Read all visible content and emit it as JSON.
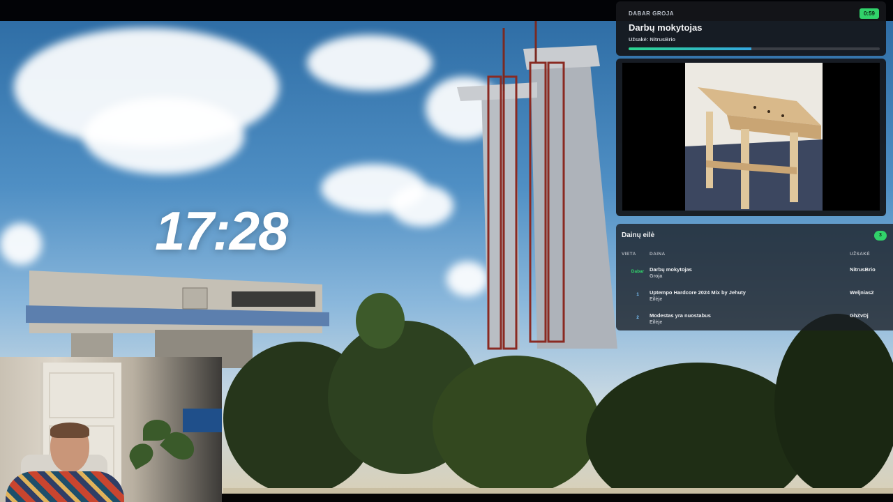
{
  "clock": {
    "time": "17:28"
  },
  "now_playing": {
    "label": "DABAR GROJA",
    "time_left": "0:59",
    "title": "Darbų mokytojas",
    "requested_by": "Užsakė: NitrusBrio",
    "progress": 0.49
  },
  "video": {
    "subject": "wooden workbench"
  },
  "queue": {
    "title": "Dainų eilė",
    "count": "3",
    "columns": {
      "position": "VIETA",
      "song": "DAINA",
      "requester": "UŽSAKĖ"
    },
    "rows": [
      {
        "position": "Dabar",
        "song": "Darbų mokytojas",
        "status": "Groja",
        "requester": "NitrusBrio"
      },
      {
        "position": "1",
        "song": "Uptempo Hardcore 2024 Mix by Jehuty",
        "status": "Eilėje",
        "requester": "Weljnias2"
      },
      {
        "position": "2",
        "song": "Modestas yra nuostabus",
        "status": "Eilėje",
        "requester": "GhZvDj"
      }
    ]
  },
  "colors": {
    "accent": "#31d26a",
    "progress_end": "#34a7e0",
    "panel_bg": "#14161a"
  }
}
